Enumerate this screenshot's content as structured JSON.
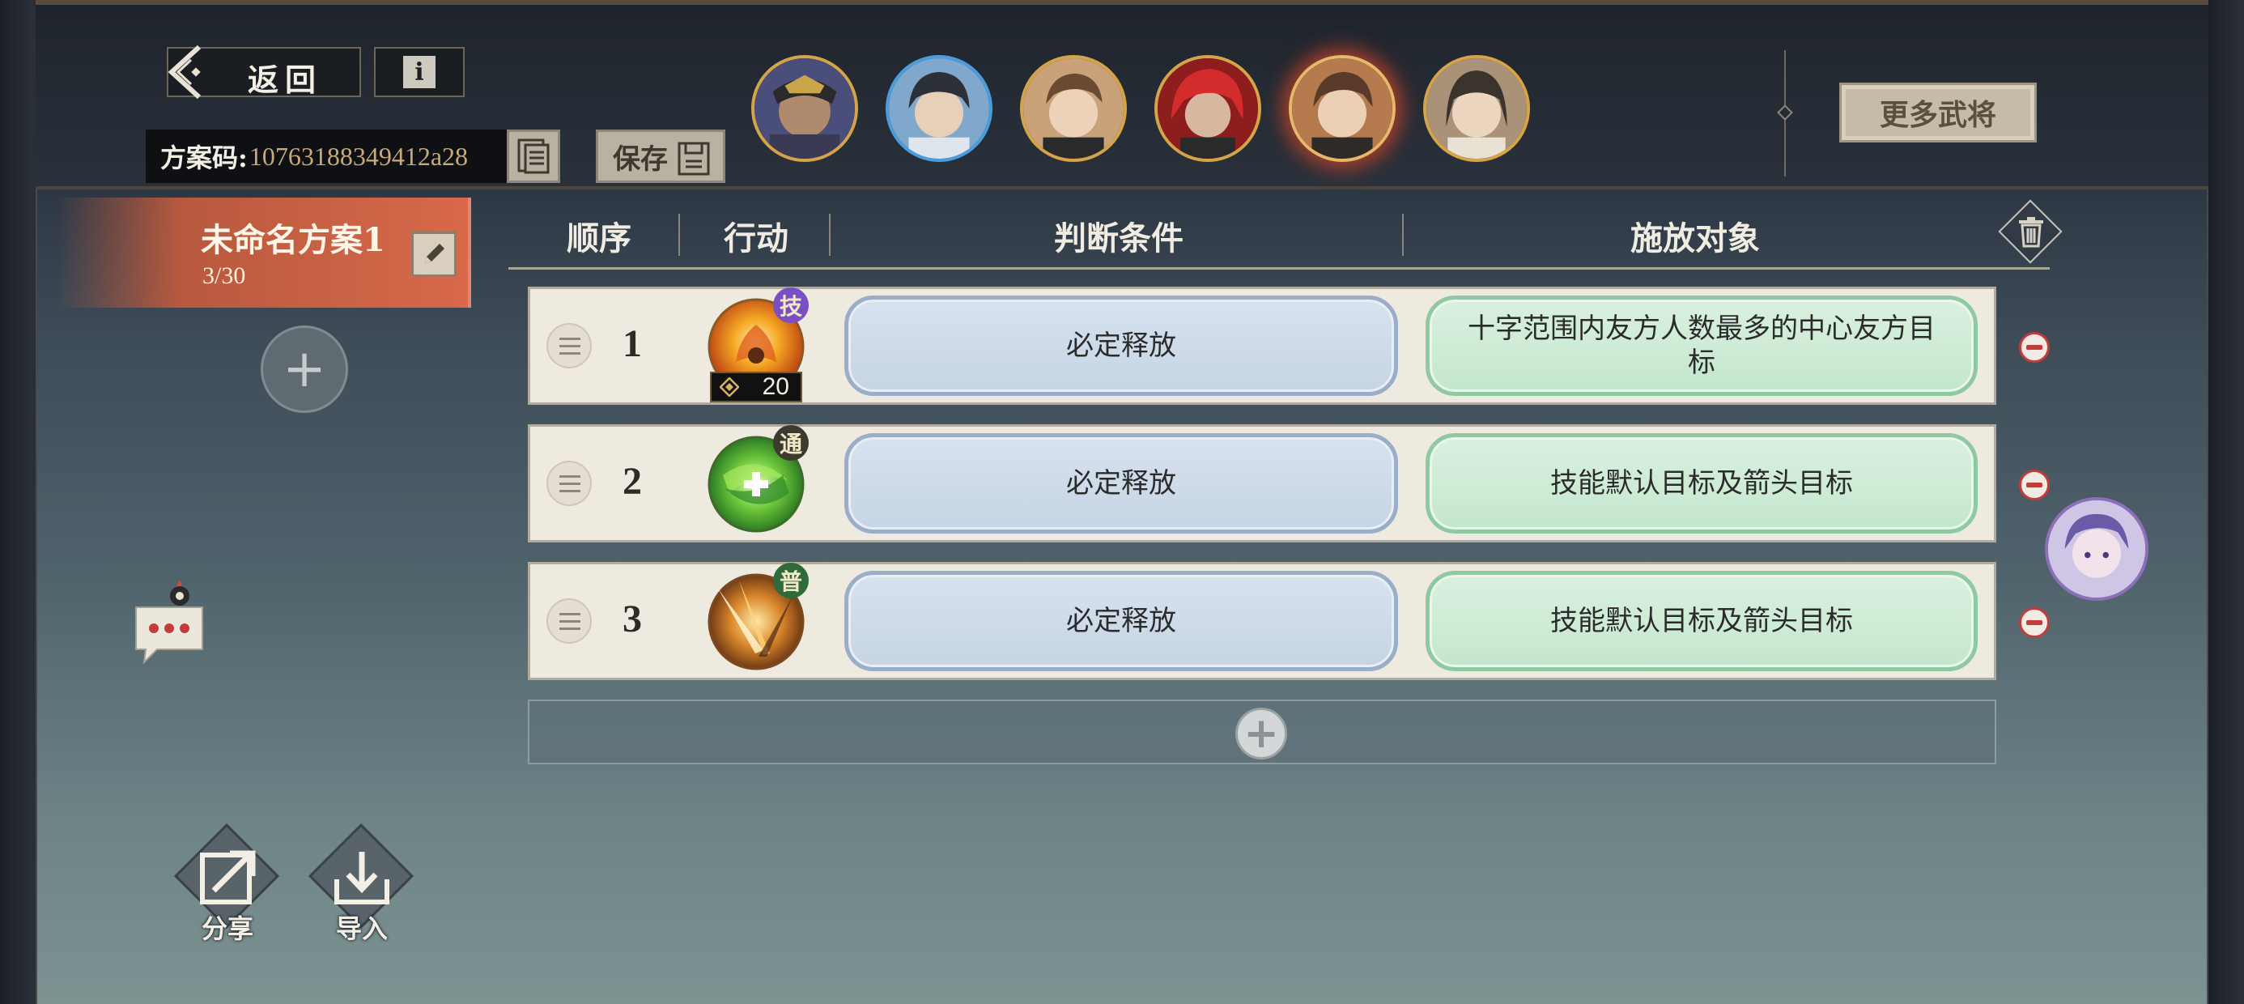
{
  "header": {
    "back_label": "返回",
    "info_label": "i",
    "code_label": "方案码:",
    "code_value": "10763188349412a28",
    "save_label": "保存",
    "more_generals_label": "更多武将"
  },
  "generals": [
    {
      "name": "general-1",
      "selected": false
    },
    {
      "name": "general-2",
      "selected": false
    },
    {
      "name": "general-3",
      "selected": false
    },
    {
      "name": "general-4",
      "selected": false
    },
    {
      "name": "general-5",
      "selected": true
    },
    {
      "name": "general-6",
      "selected": false
    }
  ],
  "plan": {
    "name": "未命名方案1",
    "count": "3/30"
  },
  "table": {
    "headers": {
      "order": "顺序",
      "action": "行动",
      "condition": "判断条件",
      "target": "施放对象"
    },
    "rows": [
      {
        "order": "1",
        "badge": "技",
        "badge_color": "#7b4fc4",
        "cost": "20",
        "condition": "必定释放",
        "target": "十字范围内友方人数最多的中心友方目标",
        "icon": "fire-skill-icon"
      },
      {
        "order": "2",
        "badge": "通",
        "badge_color": "#3d3a30",
        "cost": "",
        "condition": "必定释放",
        "target": "技能默认目标及箭头目标",
        "icon": "heal-skill-icon"
      },
      {
        "order": "3",
        "badge": "普",
        "badge_color": "#2f6b3a",
        "cost": "",
        "condition": "必定释放",
        "target": "技能默认目标及箭头目标",
        "icon": "slash-skill-icon"
      }
    ]
  },
  "footer": {
    "share_label": "分享",
    "import_label": "导入"
  },
  "colors": {
    "accent_orange": "#d8694a",
    "condition_blue": "#c6d4e4",
    "target_green": "#c4e6cd",
    "remove_red": "#c43c3a",
    "gold": "#d5a449"
  }
}
